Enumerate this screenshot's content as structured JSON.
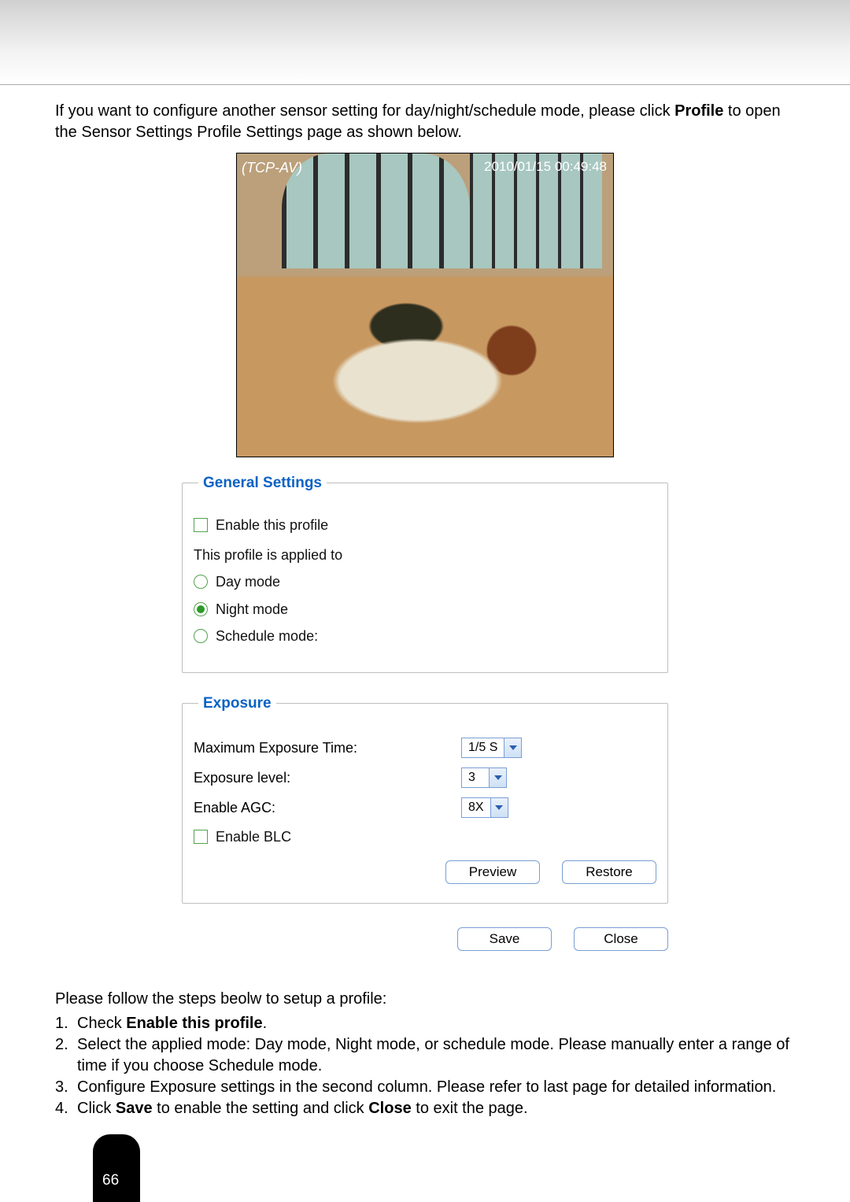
{
  "intro": {
    "line1_prefix": "If you want to configure another sensor setting for day/night/schedule mode, please click ",
    "bold1": "Profile",
    "line1_suffix": " to open the Sensor Settings Profile Settings page as shown below."
  },
  "preview": {
    "source_label": "(TCP-AV)",
    "timestamp": "2010/01/15 00:49:48"
  },
  "general": {
    "legend": "General Settings",
    "enable_profile": "Enable this profile",
    "applied_to": "This profile is applied to",
    "modes": {
      "day": "Day mode",
      "night": "Night mode",
      "schedule": "Schedule mode:",
      "selected": "night"
    }
  },
  "exposure": {
    "legend": "Exposure",
    "max_time_label": "Maximum Exposure Time:",
    "max_time_value": "1/5 S",
    "level_label": "Exposure level:",
    "level_value": "3",
    "agc_label": "Enable AGC:",
    "agc_value": "8X",
    "blc_label": "Enable BLC",
    "preview_btn": "Preview",
    "restore_btn": "Restore"
  },
  "outer": {
    "save_btn": "Save",
    "close_btn": "Close"
  },
  "instructions": {
    "lead": "Please follow the steps beolw to setup a profile:",
    "s1_prefix": "Check ",
    "s1_bold": "Enable this profile",
    "s1_suffix": ".",
    "s2": "Select the applied mode: Day mode, Night mode, or schedule mode. Please manually enter a range of time if you choose Schedule mode.",
    "s3": "Configure Exposure settings in the second column. Please refer to last page for detailed information.",
    "s4_prefix": "Click ",
    "s4_b1": "Save",
    "s4_mid": " to enable the setting and click ",
    "s4_b2": "Close",
    "s4_suffix": " to exit the page.",
    "n1": "1.",
    "n2": "2.",
    "n3": "3.",
    "n4": "4."
  },
  "page_number": "66"
}
